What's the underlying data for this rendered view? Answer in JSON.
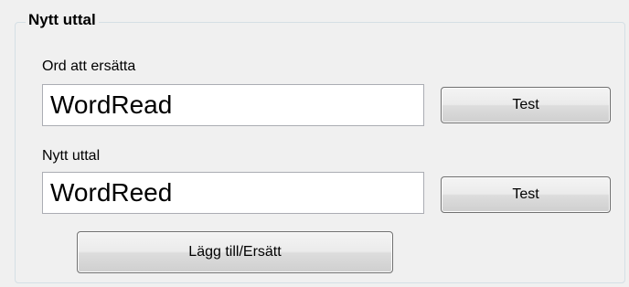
{
  "group": {
    "title": "Nytt uttal"
  },
  "original": {
    "label": "Ord att ersätta",
    "value": "WordRead",
    "test_button": "Test"
  },
  "replacement": {
    "label": "Nytt uttal",
    "value": "WordReed",
    "test_button": "Test"
  },
  "actions": {
    "add_replace_button": "Lägg till/Ersätt"
  }
}
